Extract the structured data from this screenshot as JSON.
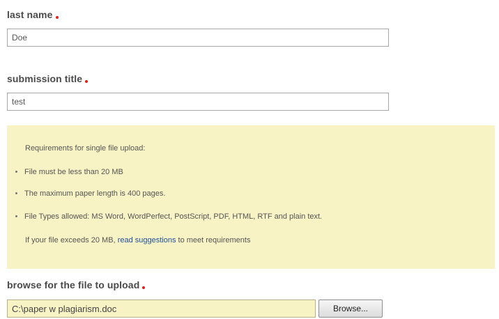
{
  "last_name": {
    "label": "last name",
    "value": "Doe"
  },
  "submission_title": {
    "label": "submission title",
    "value": "test"
  },
  "requirements": {
    "intro": "Requirements for single file upload:",
    "items": [
      "File must be less than 20 MB",
      "The maximum paper length is 400 pages.",
      "File Types allowed: MS Word, WordPerfect, PostScript, PDF, HTML, RTF and plain text."
    ],
    "note_before": "If your file exceeds 20 MB,",
    "note_link": "read suggestions",
    "note_after": "to meet requirements",
    "background_color": "#f7f3c4"
  },
  "file_upload": {
    "label": "browse for the file to upload",
    "value": "C:\\paper w plagiarism.doc",
    "browse_label": "Browse..."
  },
  "required_marker_color": "#e0201b"
}
